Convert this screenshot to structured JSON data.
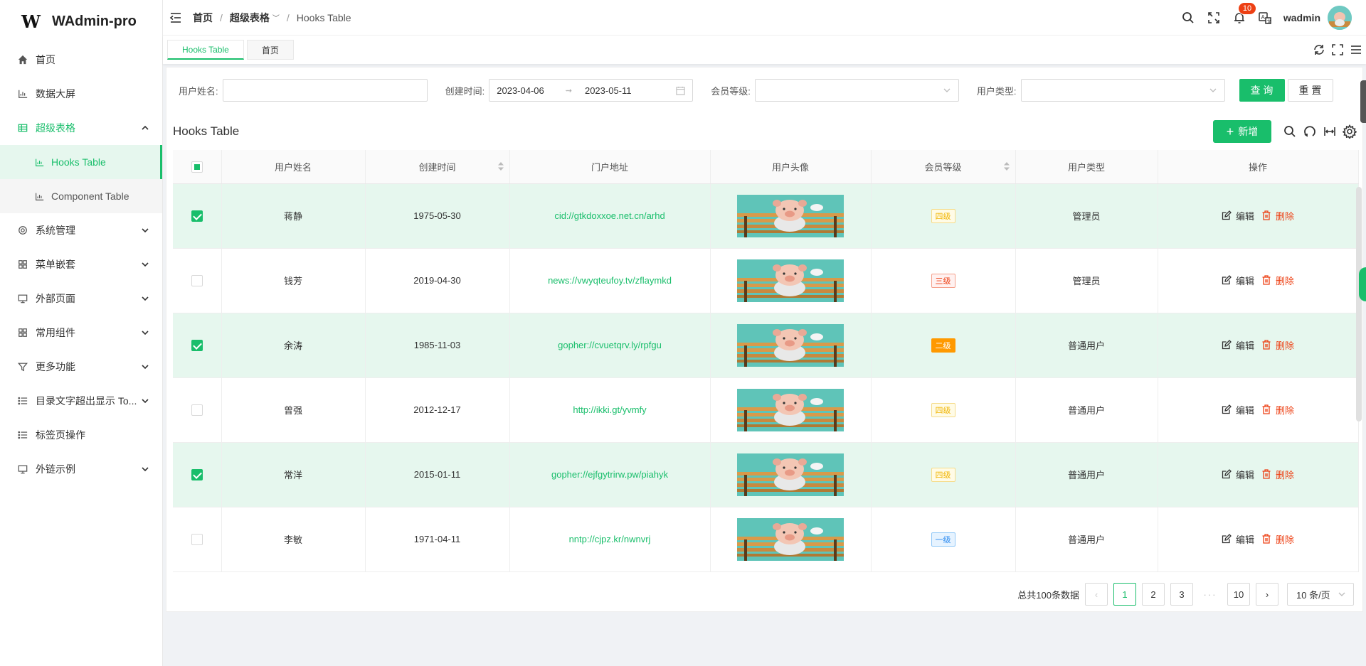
{
  "brand": {
    "logo_mark": "W",
    "name": "WAdmin-pro"
  },
  "sidebar": {
    "items": [
      {
        "label": "首页",
        "icon": "home-icon"
      },
      {
        "label": "数据大屏",
        "icon": "chart-icon"
      },
      {
        "label": "超级表格",
        "icon": "table-icon",
        "open": true,
        "children": [
          {
            "label": "Hooks Table",
            "active": true
          },
          {
            "label": "Component Table"
          }
        ]
      },
      {
        "label": "系统管理",
        "icon": "gear-icon"
      },
      {
        "label": "菜单嵌套",
        "icon": "grid-icon"
      },
      {
        "label": "外部页面",
        "icon": "monitor-icon"
      },
      {
        "label": "常用组件",
        "icon": "grid-icon"
      },
      {
        "label": "更多功能",
        "icon": "filter-icon"
      },
      {
        "label": "目录文字超出显示 To...",
        "icon": "list-icon"
      },
      {
        "label": "标签页操作",
        "icon": "list-icon"
      },
      {
        "label": "外链示例",
        "icon": "monitor-icon"
      }
    ]
  },
  "header": {
    "breadcrumb": [
      "首页",
      "超级表格",
      "Hooks Table"
    ],
    "notification_count": "10",
    "username": "wadmin"
  },
  "tabs": [
    "Hooks Table",
    "首页"
  ],
  "search": {
    "username_label": "用户姓名:",
    "username_value": "",
    "created_label": "创建时间:",
    "date_start": "2023-04-06",
    "date_end": "2023-05-11",
    "level_label": "会员等级:",
    "usertype_label": "用户类型:",
    "query_button": "查 询",
    "reset_button": "重 置"
  },
  "table": {
    "title": "Hooks Table",
    "add_button": "新增",
    "columns": [
      "用户姓名",
      "创建时间",
      "门户地址",
      "用户头像",
      "会员等级",
      "用户类型",
      "操作"
    ],
    "edit_label": "编辑",
    "delete_label": "删除",
    "rows": [
      {
        "name": "蒋静",
        "date": "1975-05-30",
        "url": "cid://gtkdoxxoe.net.cn/arhd",
        "level": "四级",
        "level_class": "l4",
        "type": "管理员",
        "checked": true
      },
      {
        "name": "钱芳",
        "date": "2019-04-30",
        "url": "news://vwyqteufoy.tv/zflaymkd",
        "level": "三级",
        "level_class": "l3",
        "type": "管理员",
        "checked": false
      },
      {
        "name": "余涛",
        "date": "1985-11-03",
        "url": "gopher://cvuetqrv.ly/rpfgu",
        "level": "二级",
        "level_class": "l2",
        "type": "普通用户",
        "checked": true
      },
      {
        "name": "曾强",
        "date": "2012-12-17",
        "url": "http://ikki.gt/yvmfy",
        "level": "四级",
        "level_class": "l4",
        "type": "普通用户",
        "checked": false
      },
      {
        "name": "常洋",
        "date": "2015-01-11",
        "url": "gopher://ejfgytrirw.pw/piahyk",
        "level": "四级",
        "level_class": "l4",
        "type": "普通用户",
        "checked": true
      },
      {
        "name": "李敏",
        "date": "1971-04-11",
        "url": "nntp://cjpz.kr/nwnvrj",
        "level": "一级",
        "level_class": "l1",
        "type": "普通用户",
        "checked": false
      }
    ]
  },
  "pagination": {
    "total_label": "总共100条数据",
    "pages": [
      "1",
      "2",
      "3"
    ],
    "ellipsis": "···",
    "last_page": "10",
    "page_size": "10 条/页",
    "current": "1"
  },
  "colors": {
    "accent": "#19be6b",
    "danger": "#ed4014"
  }
}
